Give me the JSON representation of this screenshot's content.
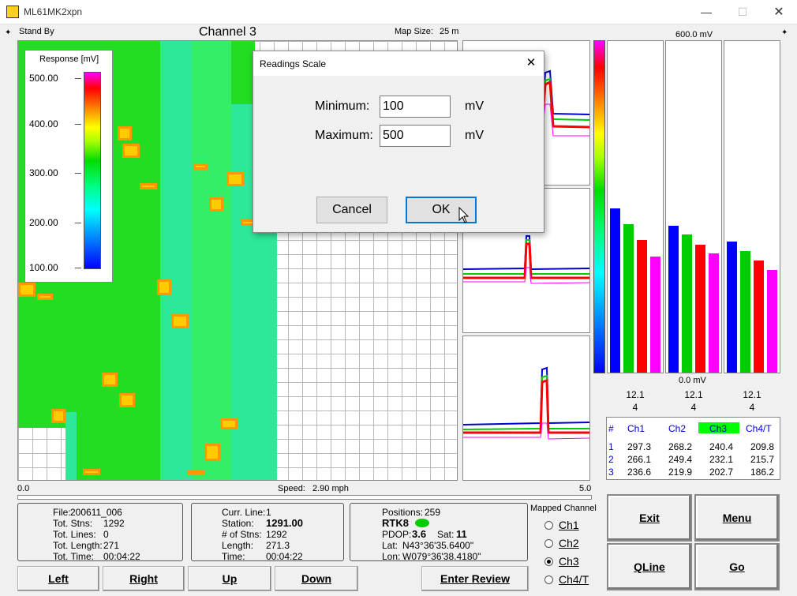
{
  "window": {
    "title": "ML61MK2xpn",
    "minimize": "—",
    "maximize": "☐",
    "close": "✕"
  },
  "top": {
    "status": "Stand By",
    "channel_title": "Channel 3",
    "map_size_label": "Map Size:",
    "map_size_value": "25 m",
    "bar_top": "600.0 mV",
    "bar_bottom": "0.0 mV"
  },
  "legend": {
    "title": "Response [mV]",
    "ticks": [
      "500.00",
      "400.00",
      "300.00",
      "200.00",
      "100.00"
    ]
  },
  "axis": {
    "left": "0.0",
    "right": "5.0",
    "speed_label": "Speed:",
    "speed_value": "2.90 mph"
  },
  "columns": [
    {
      "top": "12.1",
      "bottom": "4",
      "values": [
        297.3,
        266.1,
        236.6
      ]
    },
    {
      "top": "12.1",
      "bottom": "4",
      "values": [
        268.2,
        249.4,
        219.9
      ]
    },
    {
      "top": "12.1",
      "bottom": "4",
      "values": [
        240.4,
        232.1,
        202.7
      ]
    }
  ],
  "bar_colors": [
    "#0000ff",
    "#00cc00",
    "#ff0000",
    "#ff00ff"
  ],
  "readings": {
    "headers": [
      "#",
      "Ch1",
      "Ch2",
      "Ch3",
      "Ch4/T"
    ],
    "highlight_color": "#00ff00",
    "rows": [
      [
        "1",
        "297.3",
        "268.2",
        "240.4",
        "209.8"
      ],
      [
        "2",
        "266.1",
        "249.4",
        "232.1",
        "215.7"
      ],
      [
        "3",
        "236.6",
        "219.9",
        "202.7",
        "186.2"
      ]
    ]
  },
  "file_box": {
    "labels": [
      "File:",
      "Tot. Stns:",
      "Tot. Lines:",
      "Tot. Length:",
      "Tot. Time:"
    ],
    "values": [
      "200611_006",
      "1292",
      "0",
      "271",
      "00:04:22"
    ]
  },
  "line_box": {
    "labels": [
      "Curr. Line:",
      "Station:",
      "# of Stns:",
      "Length:",
      "Time:"
    ],
    "values": [
      "1",
      "1291.00",
      "1292",
      "271.3",
      "00:04:22"
    ]
  },
  "gps_box": {
    "positions_label": "Positions:",
    "positions_value": "259",
    "rtk": "RTK8",
    "rtk_color": "#00cc00",
    "pdop_label": "PDOP:",
    "pdop_value": "3.6",
    "sat_label": "Sat:",
    "sat_value": "11",
    "lat_label": "Lat:",
    "lat_value": "N43°36'35.6400\"",
    "lon_label": "Lon:",
    "lon_value": "W079°36'38.4180\""
  },
  "mapped_channel": {
    "label": "Mapped Channel",
    "options": [
      "Ch1",
      "Ch2",
      "Ch3",
      "Ch4/T"
    ],
    "selected": "Ch3"
  },
  "nav": {
    "left": "Left",
    "right": "Right",
    "up": "Up",
    "down": "Down",
    "review": "Enter Review"
  },
  "actions": {
    "exit": "Exit",
    "menu": "Menu",
    "qline": "QLine",
    "go": "Go"
  },
  "dialog": {
    "title": "Readings Scale",
    "close": "✕",
    "min_label": "Minimum:",
    "min_value": "100",
    "max_label": "Maximum:",
    "max_value": "500",
    "unit": "mV",
    "cancel": "Cancel",
    "ok": "OK"
  }
}
